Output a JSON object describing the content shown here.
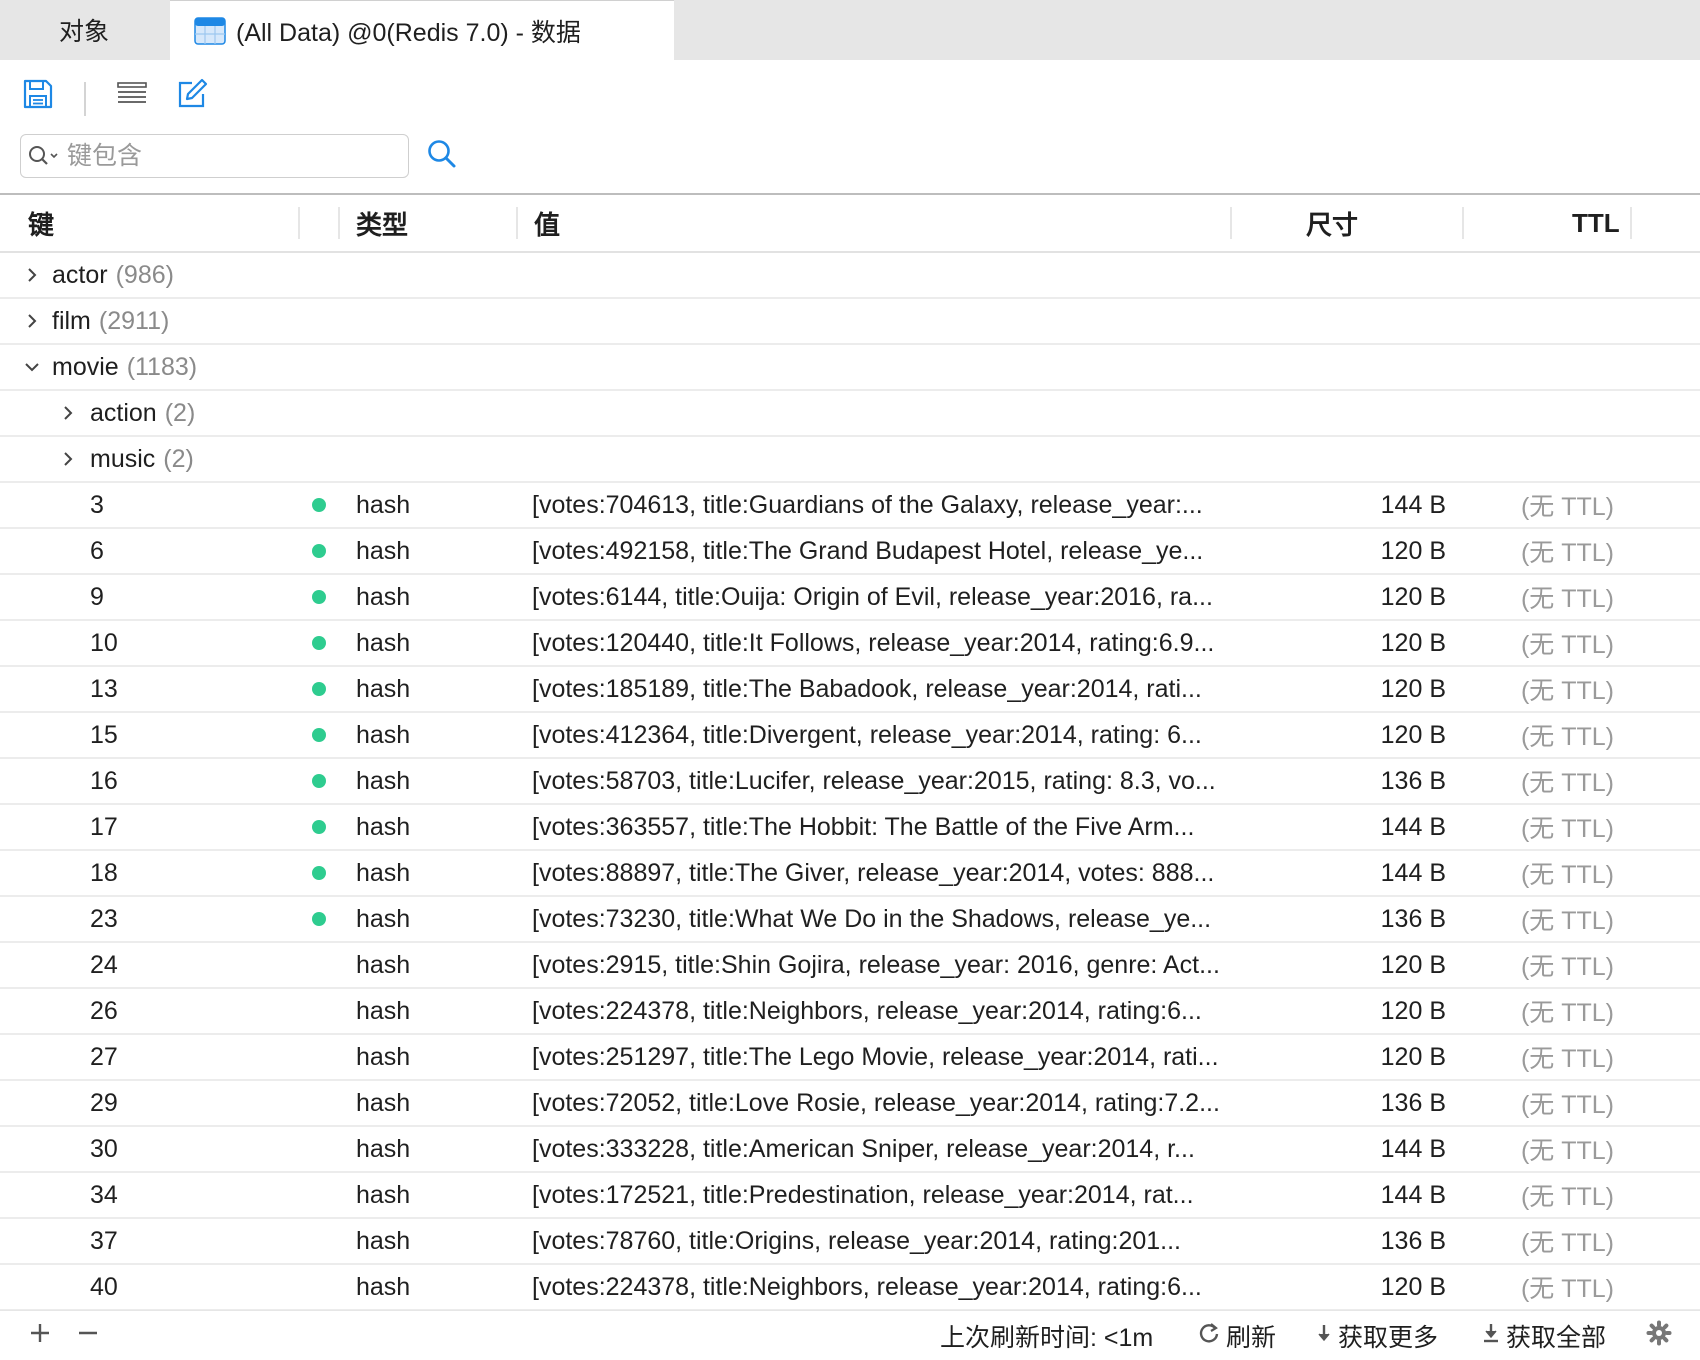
{
  "tabs": [
    {
      "label": "对象"
    },
    {
      "label": "(All Data) @0(Redis 7.0) - 数据"
    }
  ],
  "search": {
    "placeholder": "键包含",
    "value": ""
  },
  "columns": {
    "key": "键",
    "type": "类型",
    "value": "值",
    "size": "尺寸",
    "ttl": "TTL"
  },
  "groups": [
    {
      "name": "actor",
      "count": "(986)"
    },
    {
      "name": "film",
      "count": "(2911)"
    },
    {
      "name": "movie",
      "count": "(1183)"
    },
    {
      "name": "action",
      "count": "(2)"
    },
    {
      "name": "music",
      "count": "(2)"
    }
  ],
  "rows": [
    {
      "key": "3",
      "type": "hash",
      "value": "[votes:704613, title:Guardians of the Galaxy, release_year:...",
      "size": "144 B",
      "ttl": "(无 TTL)"
    },
    {
      "key": "6",
      "type": "hash",
      "value": "[votes:492158, title:The Grand Budapest Hotel, release_ye...",
      "size": "120 B",
      "ttl": "(无 TTL)"
    },
    {
      "key": "9",
      "type": "hash",
      "value": "[votes:6144, title:Ouija: Origin of Evil, release_year:2016, ra...",
      "size": "120 B",
      "ttl": "(无 TTL)"
    },
    {
      "key": "10",
      "type": "hash",
      "value": "[votes:120440, title:It Follows, release_year:2014, rating:6.9...",
      "size": "120 B",
      "ttl": "(无 TTL)"
    },
    {
      "key": "13",
      "type": "hash",
      "value": "[votes:185189, title:The Babadook, release_year:2014, rati...",
      "size": "120 B",
      "ttl": "(无 TTL)"
    },
    {
      "key": "15",
      "type": "hash",
      "value": "[votes:412364, title:Divergent, release_year:2014, rating: 6...",
      "size": "120 B",
      "ttl": "(无 TTL)"
    },
    {
      "key": "16",
      "type": "hash",
      "value": "[votes:58703, title:Lucifer, release_year:2015, rating: 8.3, vo...",
      "size": "136 B",
      "ttl": "(无 TTL)"
    },
    {
      "key": "17",
      "type": "hash",
      "value": "[votes:363557, title:The Hobbit: The Battle of the Five Arm...",
      "size": "144 B",
      "ttl": "(无 TTL)"
    },
    {
      "key": "18",
      "type": "hash",
      "value": "[votes:88897, title:The Giver, release_year:2014, votes: 888...",
      "size": "144 B",
      "ttl": "(无 TTL)"
    },
    {
      "key": "23",
      "type": "hash",
      "value": "[votes:73230, title:What We Do in the Shadows, release_ye...",
      "size": "136 B",
      "ttl": "(无 TTL)"
    },
    {
      "key": "24",
      "type": "hash",
      "value": "[votes:2915, title:Shin Gojira, release_year: 2016, genre: Act...",
      "size": "120 B",
      "ttl": "(无 TTL)"
    },
    {
      "key": "26",
      "type": "hash",
      "value": "[votes:224378, title:Neighbors, release_year:2014, rating:6...",
      "size": "120 B",
      "ttl": "(无 TTL)"
    },
    {
      "key": "27",
      "type": "hash",
      "value": "[votes:251297, title:The Lego Movie, release_year:2014, rati...",
      "size": "120 B",
      "ttl": "(无 TTL)"
    },
    {
      "key": "29",
      "type": "hash",
      "value": "[votes:72052, title:Love Rosie, release_year:2014, rating:7.2...",
      "size": "136 B",
      "ttl": "(无 TTL)"
    },
    {
      "key": "30",
      "type": "hash",
      "value": "[votes:333228, title:American Sniper, release_year:2014, r...",
      "size": "144 B",
      "ttl": "(无 TTL)"
    },
    {
      "key": "34",
      "type": "hash",
      "value": "[votes:172521, title:Predestination, release_year:2014, rat...",
      "size": "144 B",
      "ttl": "(无 TTL)"
    },
    {
      "key": "37",
      "type": "hash",
      "value": "[votes:78760, title:Origins, release_year:2014, rating:201...",
      "size": "136 B",
      "ttl": "(无 TTL)"
    },
    {
      "key": "40",
      "type": "hash",
      "value": "[votes:224378, title:Neighbors, release_year:2014, rating:6...",
      "size": "120 B",
      "ttl": "(无 TTL)"
    }
  ],
  "status": {
    "last_refresh": "上次刷新时间: <1m",
    "refresh": "刷新",
    "fetch_more": "获取更多",
    "fetch_all": "获取全部"
  },
  "colors": {
    "accent": "#1e88e5",
    "dot": "#2ecc8f"
  },
  "icons": [
    "save-icon",
    "list-view-icon",
    "edit-icon",
    "search-icon",
    "add-icon",
    "remove-icon",
    "refresh-icon",
    "download-icon",
    "gear-icon"
  ]
}
